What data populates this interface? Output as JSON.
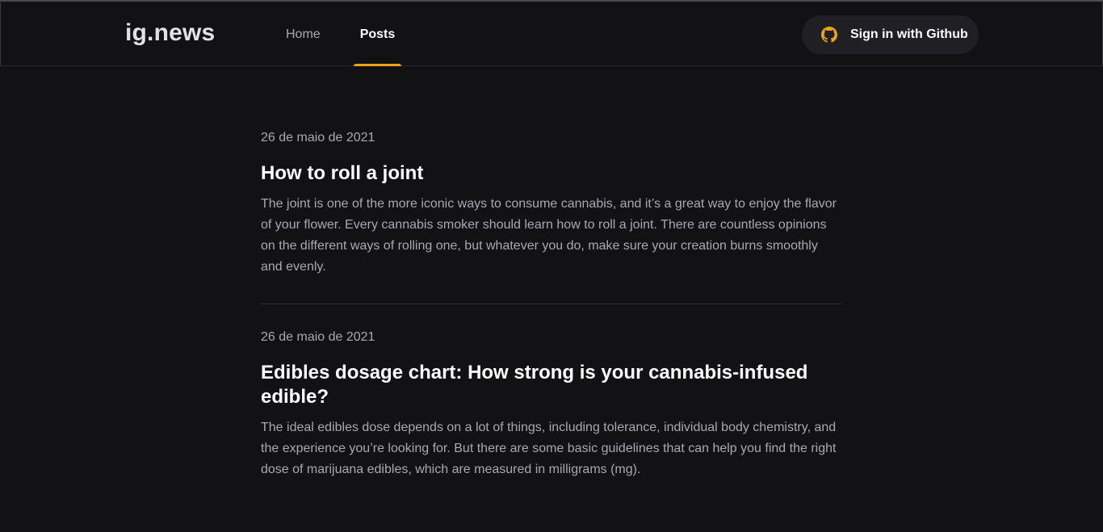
{
  "header": {
    "logo": "ig.news",
    "nav": [
      {
        "label": "Home",
        "active": false
      },
      {
        "label": "Posts",
        "active": true
      }
    ],
    "signin_label": "Sign in with Github",
    "signin_icon": "github-icon",
    "accent_color": "#eba417"
  },
  "posts": [
    {
      "date": "26 de maio de 2021",
      "title": "How to roll a joint",
      "excerpt": "The joint is one of the more iconic ways to consume cannabis, and it’s a great way to enjoy the flavor of your flower. Every cannabis smoker should learn how to roll a joint. There are countless opinions on the different ways of rolling one, but whatever you do, make sure your creation burns smoothly and evenly."
    },
    {
      "date": "26 de maio de 2021",
      "title": "Edibles dosage chart: How strong is your cannabis-infused edible?",
      "excerpt": "The ideal edibles dose depends on a lot of things, including tolerance, individual body chemistry, and the experience you’re looking for. But there are some basic guidelines that can help you find the right dose of marijuana edibles, which are measured in milligrams (mg)."
    }
  ]
}
